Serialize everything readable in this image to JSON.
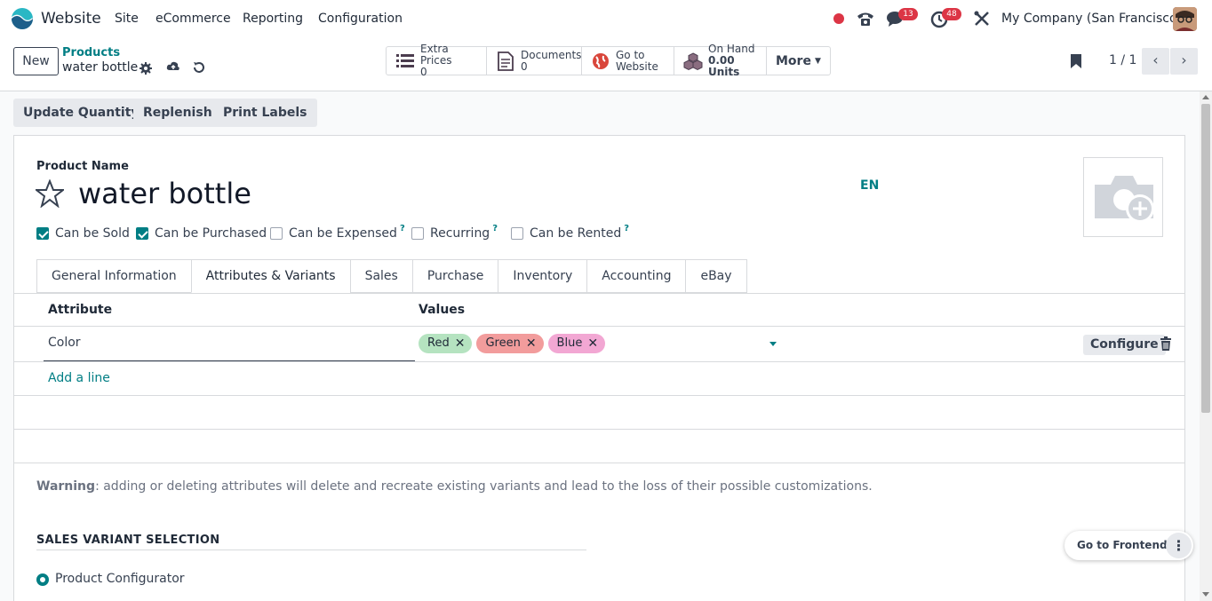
{
  "navbar": {
    "app_name": "Website",
    "menus": [
      "Site",
      "eCommerce",
      "Reporting",
      "Configuration"
    ],
    "chat_badge": "13",
    "activity_badge": "48",
    "company": "My Company (San Francisco)"
  },
  "control": {
    "new_label": "New",
    "breadcrumb_parent": "Products",
    "breadcrumb_current": "water bottle",
    "smart_buttons": [
      {
        "icon": "list-icon",
        "label": "Extra Prices",
        "value": "0"
      },
      {
        "icon": "document-icon",
        "label": "Documents",
        "value": "0"
      },
      {
        "icon": "globe-icon",
        "label": "Go to",
        "value": "Website"
      },
      {
        "icon": "cubes-icon",
        "label": "On Hand",
        "value": "0.00 Units"
      }
    ],
    "more_label": "More",
    "pager": "1 / 1"
  },
  "actions": [
    "Update Quantity",
    "Replenish",
    "Print Labels"
  ],
  "form": {
    "name_label": "Product Name",
    "name": "water bottle",
    "lang": "EN",
    "checkboxes": [
      {
        "label": "Can be Sold",
        "checked": true,
        "help": ""
      },
      {
        "label": "Can be Purchased",
        "checked": true,
        "help": ""
      },
      {
        "label": "Can be Expensed",
        "checked": false,
        "help": "?"
      },
      {
        "label": "Recurring",
        "checked": false,
        "help": "?"
      },
      {
        "label": "Can be Rented",
        "checked": false,
        "help": "?"
      }
    ],
    "tabs": [
      "General Information",
      "Attributes & Variants",
      "Sales",
      "Purchase",
      "Inventory",
      "Accounting",
      "eBay"
    ],
    "active_tab": "Attributes & Variants",
    "table": {
      "headers": [
        "Attribute",
        "Values"
      ],
      "rows": [
        {
          "attribute": "Color",
          "values": [
            {
              "label": "Red",
              "color": "#b5e3c0"
            },
            {
              "label": "Green",
              "color": "#f29c9c"
            },
            {
              "label": "Blue",
              "color": "#f2a7d3"
            }
          ],
          "configure_label": "Configure"
        }
      ],
      "add_line": "Add a line"
    },
    "warning_bold": "Warning",
    "warning_text": ": adding or deleting attributes will delete and recreate existing variants and lead to the loss of their possible customizations.",
    "section_title": "SALES VARIANT SELECTION",
    "radio_label": "Product Configurator"
  },
  "floating": {
    "label": "Go to Frontend"
  },
  "colors": {
    "accent": "#017e84",
    "badge": "#dc3545"
  }
}
